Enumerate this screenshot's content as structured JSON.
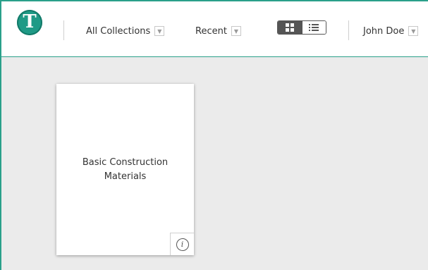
{
  "header": {
    "logo_letter": "T",
    "collections_label": "All Collections",
    "recent_label": "Recent",
    "user_name": "John Doe",
    "view_mode": "grid"
  },
  "cards": [
    {
      "title": "Basic Construction Materials"
    }
  ],
  "colors": {
    "accent": "#1f9a86",
    "background": "#ebebeb"
  }
}
